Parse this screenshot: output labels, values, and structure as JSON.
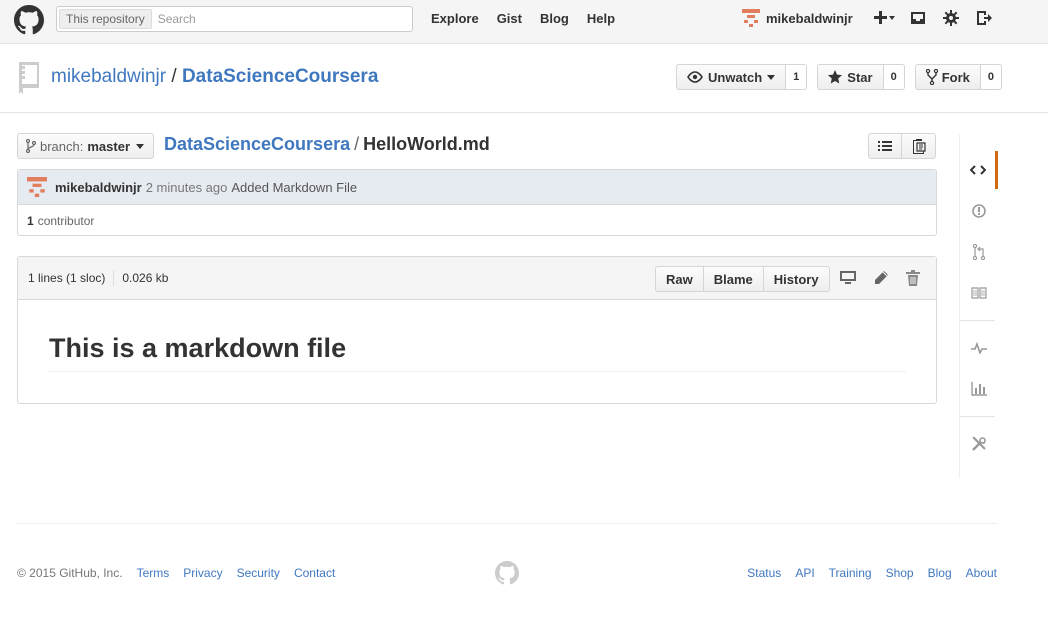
{
  "header": {
    "search_scope": "This repository",
    "search_placeholder": "Search",
    "nav": [
      "Explore",
      "Gist",
      "Blog",
      "Help"
    ],
    "username": "mikebaldwinjr"
  },
  "repo": {
    "owner": "mikebaldwinjr",
    "separator": "/",
    "name": "DataScienceCoursera",
    "actions": {
      "watch_label": "Unwatch",
      "watch_count": "1",
      "star_label": "Star",
      "star_count": "0",
      "fork_label": "Fork",
      "fork_count": "0"
    }
  },
  "file_nav": {
    "branch_label": "branch:",
    "branch_value": "master",
    "breadcrumb_root": "DataScienceCoursera",
    "breadcrumb_sep": "/",
    "breadcrumb_file": "HelloWorld.md"
  },
  "commit": {
    "author": "mikebaldwinjr",
    "time": "2 minutes ago",
    "message": "Added Markdown File",
    "contributors_count": "1",
    "contributors_label": "contributor"
  },
  "file": {
    "lines": "1 lines (1 sloc)",
    "size": "0.026 kb",
    "raw_label": "Raw",
    "blame_label": "Blame",
    "history_label": "History",
    "heading": "This is a markdown file"
  },
  "sidebar": {
    "icons": [
      "code-icon",
      "issue-icon",
      "pull-request-icon",
      "wiki-icon",
      "pulse-icon",
      "graph-icon",
      "settings-icon"
    ],
    "active_color": "#d26911"
  },
  "footer": {
    "copyright": "© 2015 GitHub, Inc.",
    "left_links": [
      "Terms",
      "Privacy",
      "Security",
      "Contact"
    ],
    "right_links": [
      "Status",
      "API",
      "Training",
      "Shop",
      "Blog",
      "About"
    ]
  },
  "colors": {
    "link": "#4078c0",
    "header_bg": "#f5f5f5",
    "commit_bg": "#e6ebf1",
    "avatar": "#e07e5e"
  }
}
